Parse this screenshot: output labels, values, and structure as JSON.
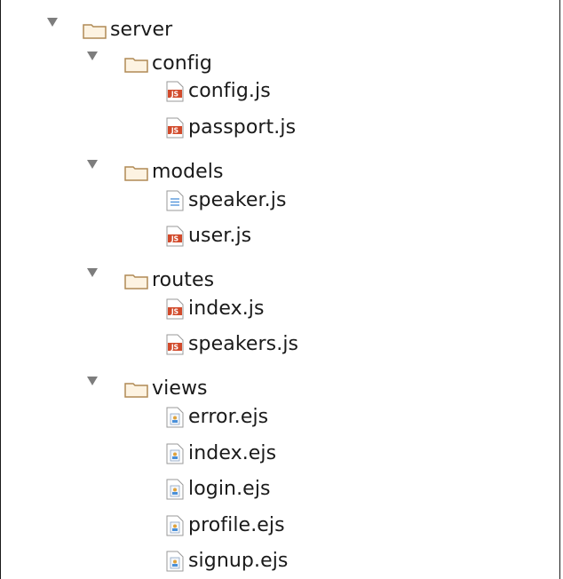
{
  "tree": {
    "root": {
      "label": "server",
      "expanded": true,
      "icon": "folder-icon"
    },
    "folders": [
      {
        "label": "config",
        "expanded": true,
        "icon": "folder-icon",
        "files": [
          {
            "label": "config.js",
            "icon": "js-file-icon"
          },
          {
            "label": "passport.js",
            "icon": "js-file-icon"
          }
        ]
      },
      {
        "label": "models",
        "expanded": true,
        "icon": "folder-icon",
        "files": [
          {
            "label": "speaker.js",
            "icon": "text-file-icon"
          },
          {
            "label": "user.js",
            "icon": "js-file-icon"
          }
        ]
      },
      {
        "label": "routes",
        "expanded": true,
        "icon": "folder-icon",
        "files": [
          {
            "label": "index.js",
            "icon": "js-file-icon"
          },
          {
            "label": "speakers.js",
            "icon": "js-file-icon"
          }
        ]
      },
      {
        "label": "views",
        "expanded": true,
        "icon": "folder-icon",
        "files": [
          {
            "label": "error.ejs",
            "icon": "ejs-file-icon"
          },
          {
            "label": "index.ejs",
            "icon": "ejs-file-icon"
          },
          {
            "label": "login.ejs",
            "icon": "ejs-file-icon"
          },
          {
            "label": "profile.ejs",
            "icon": "ejs-file-icon"
          },
          {
            "label": "signup.ejs",
            "icon": "ejs-file-icon"
          }
        ]
      }
    ]
  },
  "colors": {
    "folder_stroke": "#b08a55",
    "folder_fill": "#fdf3e2",
    "js_badge": "#d24b2c",
    "text": "#1a1a1a",
    "arrow": "#7d7d7d"
  }
}
